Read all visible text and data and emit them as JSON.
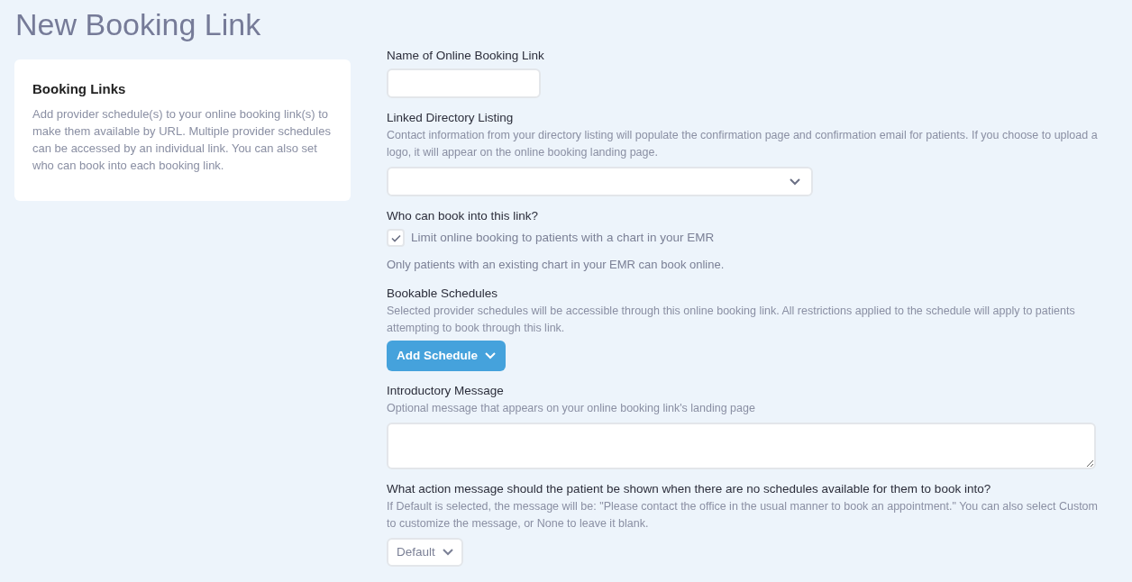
{
  "title": "New Booking Link",
  "info_card": {
    "heading": "Booking Links",
    "body": "Add provider schedule(s) to your online booking link(s) to make them available by URL. Multiple provider schedules can be accessed by an individual link. You can also set who can book into each booking link."
  },
  "fields": [
    {
      "kind": "text",
      "label": "Name of Online Booking Link"
    },
    {
      "kind": "select",
      "label": "Linked Directory Listing",
      "help": "Contact information from your directory listing will populate the confirmation page and confirmation email for patients. If you choose to upload a logo, it will appear on the online booking landing page."
    },
    {
      "kind": "checkbox",
      "label": "Who can book into this link?",
      "option": "Limit online booking to patients with a chart in your EMR",
      "checked": true,
      "note": "Only patients with an existing chart in your EMR can book online."
    },
    {
      "kind": "button",
      "label": "Bookable Schedules",
      "help": "Selected provider schedules will be accessible through this online booking link. All restrictions applied to the schedule will apply to patients attempting to book through this link.",
      "button": "Add Schedule"
    },
    {
      "kind": "textarea",
      "label": "Introductory Message",
      "help": "Optional message that appears on your online booking link's landing page"
    },
    {
      "kind": "dropdown",
      "label": "What action message should the patient be shown when there are no schedules available for them to book into?",
      "help": "If Default is selected, the message will be: \"Please contact the office in the usual manner to book an appointment.\" You can also select Custom to customize the message, or None to leave it blank.",
      "value": "Default"
    }
  ]
}
